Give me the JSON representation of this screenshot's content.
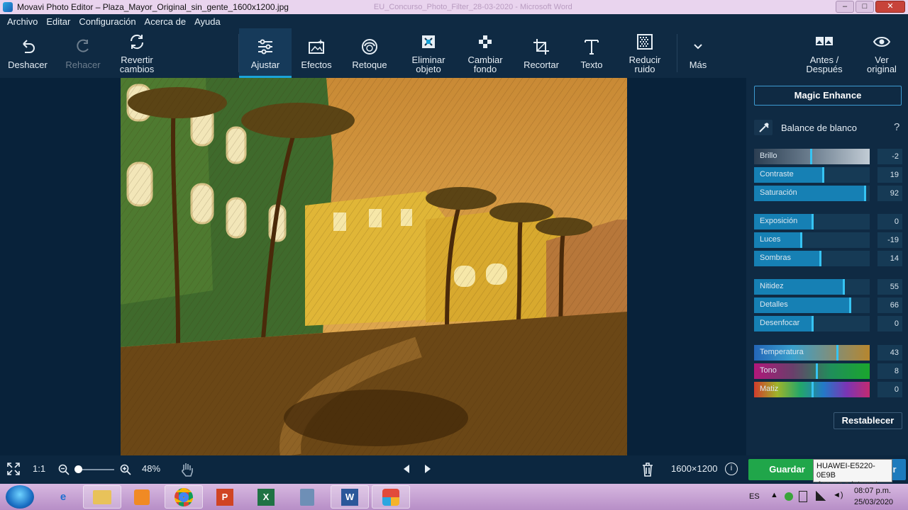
{
  "window": {
    "title": "Movavi Photo Editor – Plaza_Mayor_Original_sin_gente_1600x1200.jpg",
    "background_title": "EU_Concurso_Photo_Filter_28-03-2020 - Microsoft Word",
    "buttons": {
      "minimize": "–",
      "maximize": "□",
      "close": "✕"
    }
  },
  "menu": [
    "Archivo",
    "Editar",
    "Configuración",
    "Acerca de",
    "Ayuda"
  ],
  "toolbar": {
    "undo": "Deshacer",
    "redo": "Rehacer",
    "revert": "Revertir\ncambios",
    "adjust": "Ajustar",
    "effects": "Efectos",
    "retouch": "Retoque",
    "remove_object": "Eliminar\nobjeto",
    "change_background": "Cambiar\nfondo",
    "crop": "Recortar",
    "text": "Texto",
    "reduce_noise": "Reducir\nruido",
    "more": "Más",
    "before_after": "Antes /\nDespués",
    "view_original": "Ver\noriginal"
  },
  "panel": {
    "magic_enhance": "Magic Enhance",
    "white_balance": "Balance de blanco",
    "help": "?",
    "sliders": [
      {
        "label": "Brillo",
        "value": "-2",
        "level": -2
      },
      {
        "label": "Contraste",
        "value": "19",
        "level": 19
      },
      {
        "label": "Saturación",
        "value": "92",
        "level": 92
      },
      {
        "label": "Exposición",
        "value": "0",
        "level": 0
      },
      {
        "label": "Luces",
        "value": "-19",
        "level": -19
      },
      {
        "label": "Sombras",
        "value": "14",
        "level": 14
      },
      {
        "label": "Nitidez",
        "value": "55",
        "level": 55
      },
      {
        "label": "Detalles",
        "value": "66",
        "level": 66
      },
      {
        "label": "Desenfocar",
        "value": "0",
        "level": 0
      },
      {
        "label": "Temperatura",
        "value": "43",
        "level": 43
      },
      {
        "label": "Tono",
        "value": "8",
        "level": 8
      },
      {
        "label": "Matiz",
        "value": "0",
        "level": 0
      }
    ],
    "reset": "Restablecer"
  },
  "bottom": {
    "fit": "1:1",
    "zoom": "48%",
    "dimensions": "1600×1200",
    "save": "Guardar",
    "export_partial": "r"
  },
  "tooltip": {
    "title": "HUAWEI-E5220-0E9B",
    "subtitle": "Acceso a Internet"
  },
  "taskbar": {
    "language": "ES",
    "time": "08:07 p.m.",
    "date": "25/03/2020"
  }
}
